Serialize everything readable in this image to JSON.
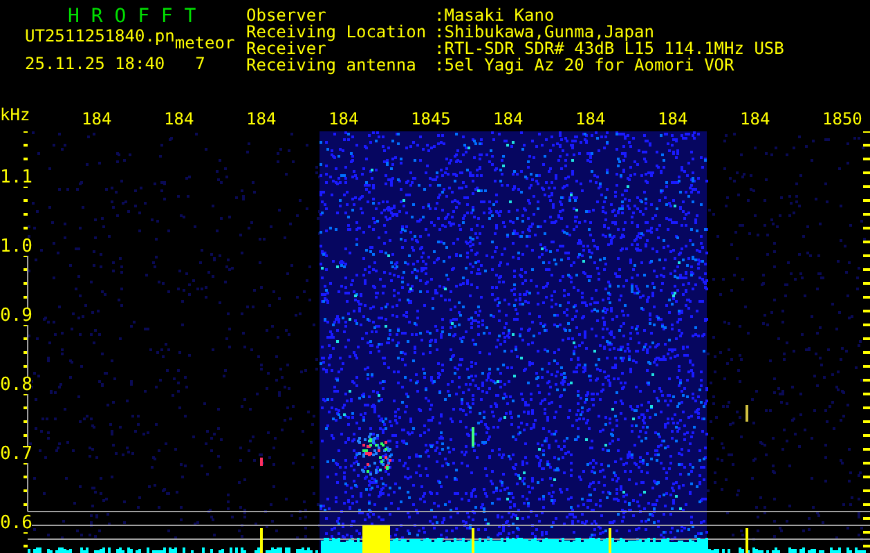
{
  "app_title": "H R O F F T",
  "file_name": "UT2511251840.pn",
  "label": "meteor",
  "timestamp": "25.11.25 18:40",
  "count": "7",
  "info": [
    {
      "label": "Observer",
      "value": ":Masaki Kano"
    },
    {
      "label": "Receiving Location",
      "value": ":Shibukawa,Gunma,Japan"
    },
    {
      "label": "Receiver",
      "value": ":RTL-SDR SDR# 43dB L15 114.1MHz USB"
    },
    {
      "label": "Receiving antenna",
      "value": ":5el Yagi Az 20 for Aomori VOR"
    }
  ],
  "y_unit": "kHz",
  "x_ticks": [
    "184",
    "184",
    "184",
    "184",
    "1845",
    "184",
    "184",
    "184",
    "184",
    "1850"
  ],
  "y_ticks": [
    "1.1",
    "1.0",
    "0.9",
    "0.8",
    "0.7",
    "0.6"
  ]
}
